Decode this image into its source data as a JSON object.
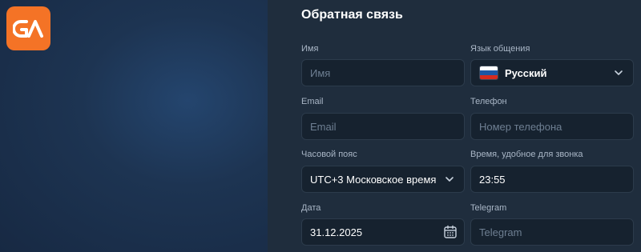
{
  "form": {
    "title": "Обратная связь",
    "fields": {
      "name": {
        "label": "Имя",
        "placeholder": "Имя"
      },
      "language": {
        "label": "Язык общения",
        "value": "Русский",
        "flag": "russian-flag-icon"
      },
      "email": {
        "label": "Email",
        "placeholder": "Email"
      },
      "phone": {
        "label": "Телефон",
        "placeholder": "Номер телефона"
      },
      "timezone": {
        "label": "Часовой пояс",
        "value": "UTC+3 Московское время"
      },
      "call_time": {
        "label": "Время, удобное для звонка",
        "value": "23:55"
      },
      "date": {
        "label": "Дата",
        "value": "31.12.2025"
      },
      "telegram": {
        "label": "Telegram",
        "placeholder": "Telegram"
      }
    }
  },
  "colors": {
    "brand": "#f47326",
    "panel": "#1f2d3d",
    "field": "#16222f"
  }
}
